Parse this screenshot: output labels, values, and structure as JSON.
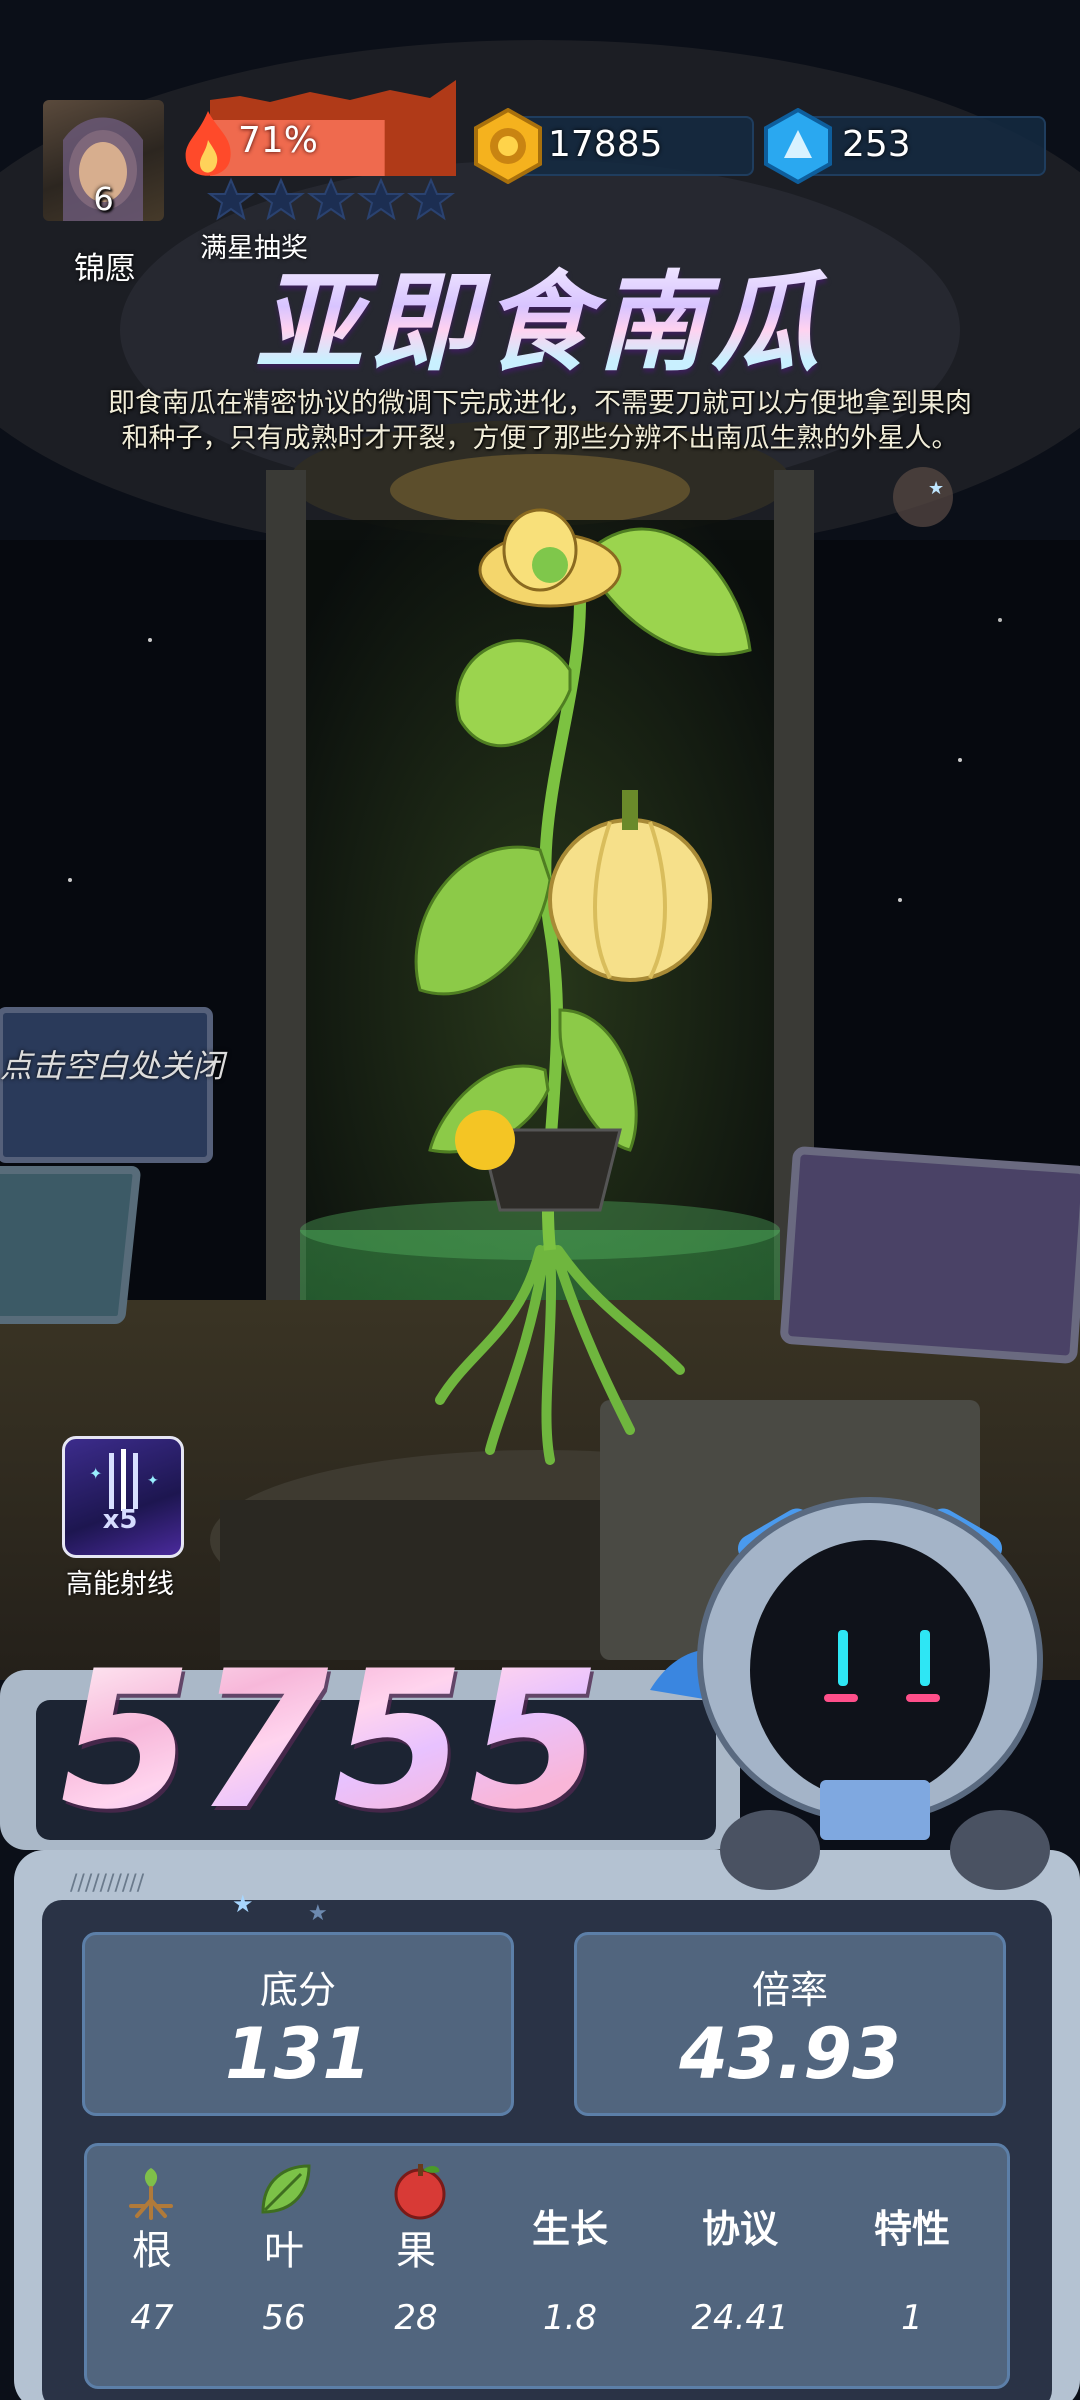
{
  "player": {
    "name": "锦愿",
    "level": "6"
  },
  "energy": {
    "percent_text": "71%",
    "fill": 0.71,
    "stars_filled": 0,
    "stars_total": 5
  },
  "star_lottery_label": "满星抽奖",
  "resources": {
    "coins": "17885",
    "gems": "253"
  },
  "plant": {
    "title": "亚即食南瓜",
    "description_line1": "即食南瓜在精密协议的微调下完成进化，不需要刀就可以方便地拿到果肉",
    "description_line2": "和种子，只有成熟时才开裂，方便了那些分辨不出南瓜生熟的外星人。"
  },
  "close_hint": "点击空白处关闭",
  "skill": {
    "label": "高能射线",
    "count": "x5"
  },
  "score": "5755",
  "base_score": {
    "label": "底分",
    "value": "131"
  },
  "multiplier": {
    "label": "倍率",
    "value": "43.93"
  },
  "stats": [
    {
      "label": "根",
      "value": "47",
      "icon": "root-icon"
    },
    {
      "label": "叶",
      "value": "56",
      "icon": "leaf-icon"
    },
    {
      "label": "果",
      "value": "28",
      "icon": "fruit-icon"
    },
    {
      "label": "生长",
      "value": "1.8"
    },
    {
      "label": "协议",
      "value": "24.41"
    },
    {
      "label": "特性",
      "value": "1"
    }
  ],
  "colors": {
    "accent_pink": "#f7b8da",
    "panel": "#51657e",
    "energy": "#ef6a4e"
  }
}
